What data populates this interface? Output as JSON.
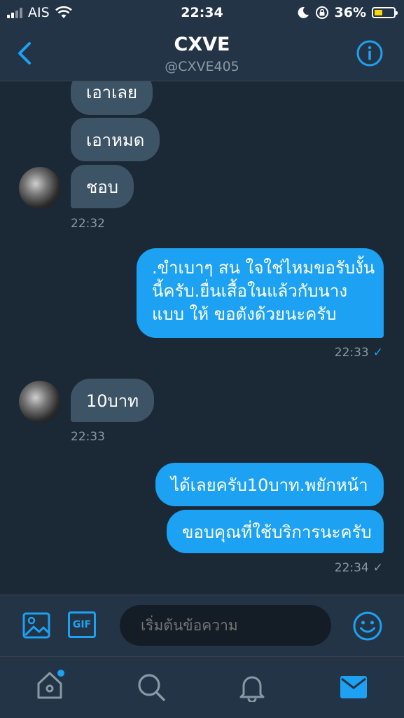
{
  "status": {
    "carrier": "AIS",
    "time": "22:34",
    "battery": "36%"
  },
  "header": {
    "title": "CXVE",
    "handle": "@CXVE405"
  },
  "messages": {
    "m1": "เอาเลย",
    "m2": "เอาหมด",
    "m3": "ชอบ",
    "t1": "22:32",
    "o1_line1": ".ขำเบาๆ สน ใจใช่ไหมขอรับงั้น",
    "o1_line2": "นี้ครับ.ยื่นเสื้อในแล้วกับนาง",
    "o1_line3": "แบบ ให้ ขอตังด้วยนะครับ",
    "t2": "22:33",
    "m4": "10บาท",
    "t3": "22:33",
    "o2": "ได้เลยครับ10บาท.พยักหน้า",
    "o3": "ขอบคุณที่ใช้บริการนะครับ",
    "t4": "22:34",
    "read_mark": "✓"
  },
  "composer": {
    "placeholder": "เริ่มต้นข้อความ",
    "gif_label": "GIF"
  },
  "colors": {
    "accent": "#1da1f2",
    "background": "#1b2836",
    "bar": "#243447",
    "incoming_bubble": "#3d5466",
    "muted": "#8899a6"
  },
  "icons": [
    "back-icon",
    "info-icon",
    "image-icon",
    "gif-icon",
    "emoji-icon",
    "home-icon",
    "search-icon",
    "bell-icon",
    "mail-icon"
  ]
}
